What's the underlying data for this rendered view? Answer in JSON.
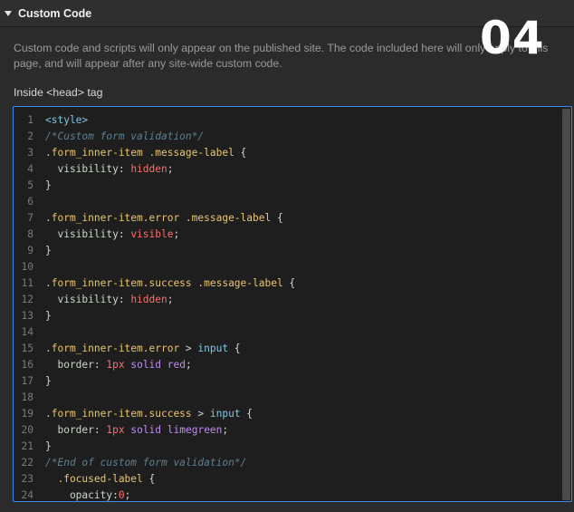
{
  "panel": {
    "title": "Custom Code",
    "step_badge": "04"
  },
  "description": "Custom code and scripts will only appear on the published site. The code included here will only apply to this page, and will appear after any site-wide custom code.",
  "head_field": {
    "label": "Inside <head> tag"
  },
  "code_lines": [
    {
      "n": "1",
      "tokens": [
        {
          "t": "<style>",
          "c": "tag"
        }
      ]
    },
    {
      "n": "2",
      "tokens": [
        {
          "t": "/*Custom form validation*/",
          "c": "com"
        }
      ]
    },
    {
      "n": "3",
      "tokens": [
        {
          "t": ".form_inner-item .message-label",
          "c": "sel"
        },
        {
          "t": " {",
          "c": ""
        }
      ]
    },
    {
      "n": "4",
      "tokens": [
        {
          "t": "  visibility",
          "c": "prop"
        },
        {
          "t": ": ",
          "c": ""
        },
        {
          "t": "hidden",
          "c": "val"
        },
        {
          "t": ";",
          "c": ""
        }
      ]
    },
    {
      "n": "5",
      "tokens": [
        {
          "t": "}",
          "c": ""
        }
      ]
    },
    {
      "n": "6",
      "tokens": []
    },
    {
      "n": "7",
      "tokens": [
        {
          "t": ".form_inner-item.error .message-label",
          "c": "sel"
        },
        {
          "t": " {",
          "c": ""
        }
      ]
    },
    {
      "n": "8",
      "tokens": [
        {
          "t": "  visibility",
          "c": "prop"
        },
        {
          "t": ": ",
          "c": ""
        },
        {
          "t": "visible",
          "c": "val"
        },
        {
          "t": ";",
          "c": ""
        }
      ]
    },
    {
      "n": "9",
      "tokens": [
        {
          "t": "}",
          "c": ""
        }
      ]
    },
    {
      "n": "10",
      "tokens": []
    },
    {
      "n": "11",
      "tokens": [
        {
          "t": ".form_inner-item.success .message-label",
          "c": "sel"
        },
        {
          "t": " {",
          "c": ""
        }
      ]
    },
    {
      "n": "12",
      "tokens": [
        {
          "t": "  visibility",
          "c": "prop"
        },
        {
          "t": ": ",
          "c": ""
        },
        {
          "t": "hidden",
          "c": "val"
        },
        {
          "t": ";",
          "c": ""
        }
      ]
    },
    {
      "n": "13",
      "tokens": [
        {
          "t": "}",
          "c": ""
        }
      ]
    },
    {
      "n": "14",
      "tokens": []
    },
    {
      "n": "15",
      "tokens": [
        {
          "t": ".form_inner-item.error",
          "c": "sel"
        },
        {
          "t": " > ",
          "c": ""
        },
        {
          "t": "input",
          "c": "elem"
        },
        {
          "t": " {",
          "c": ""
        }
      ]
    },
    {
      "n": "16",
      "tokens": [
        {
          "t": "  border",
          "c": "prop"
        },
        {
          "t": ": ",
          "c": ""
        },
        {
          "t": "1px",
          "c": "num"
        },
        {
          "t": " ",
          "c": ""
        },
        {
          "t": "solid",
          "c": "kw"
        },
        {
          "t": " ",
          "c": ""
        },
        {
          "t": "red",
          "c": "kw"
        },
        {
          "t": ";",
          "c": ""
        }
      ]
    },
    {
      "n": "17",
      "tokens": [
        {
          "t": "}",
          "c": ""
        }
      ]
    },
    {
      "n": "18",
      "tokens": []
    },
    {
      "n": "19",
      "tokens": [
        {
          "t": ".form_inner-item.success",
          "c": "sel"
        },
        {
          "t": " > ",
          "c": ""
        },
        {
          "t": "input",
          "c": "elem"
        },
        {
          "t": " {",
          "c": ""
        }
      ]
    },
    {
      "n": "20",
      "tokens": [
        {
          "t": "  border",
          "c": "prop"
        },
        {
          "t": ": ",
          "c": ""
        },
        {
          "t": "1px",
          "c": "num"
        },
        {
          "t": " ",
          "c": ""
        },
        {
          "t": "solid",
          "c": "kw"
        },
        {
          "t": " ",
          "c": ""
        },
        {
          "t": "limegreen",
          "c": "kw"
        },
        {
          "t": ";",
          "c": ""
        }
      ]
    },
    {
      "n": "21",
      "tokens": [
        {
          "t": "}",
          "c": ""
        }
      ]
    },
    {
      "n": "22",
      "tokens": [
        {
          "t": "/*End of custom form validation*/",
          "c": "com"
        }
      ]
    },
    {
      "n": "23",
      "tokens": [
        {
          "t": "  .focused-label",
          "c": "sel"
        },
        {
          "t": " {",
          "c": ""
        }
      ]
    },
    {
      "n": "24",
      "tokens": [
        {
          "t": "    opacity",
          "c": "prop"
        },
        {
          "t": ":",
          "c": ""
        },
        {
          "t": "0",
          "c": "num"
        },
        {
          "t": ";",
          "c": ""
        }
      ]
    }
  ],
  "colors": {
    "accent_border": "#3f8cf0",
    "editor_bg": "#1e1e1e",
    "panel_bg": "#2b2b2b"
  }
}
